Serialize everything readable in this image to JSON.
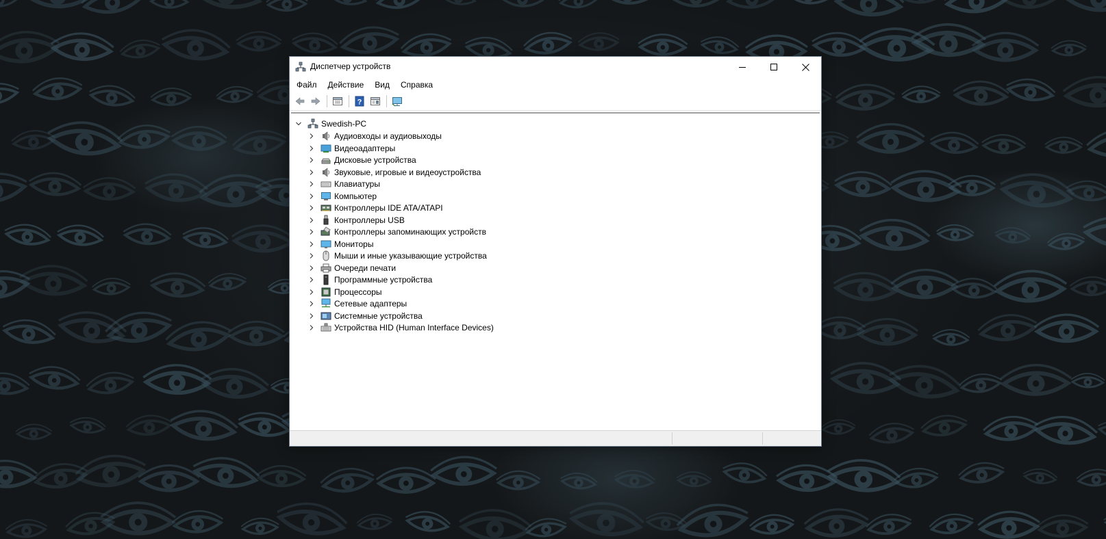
{
  "window": {
    "title": "Диспетчер устройств",
    "icon": "device-manager-icon"
  },
  "menu": [
    {
      "label": "Файл"
    },
    {
      "label": "Действие"
    },
    {
      "label": "Вид"
    },
    {
      "label": "Справка"
    }
  ],
  "toolbar": [
    {
      "name": "back-button",
      "icon": "arrow-left-icon"
    },
    {
      "name": "forward-button",
      "icon": "arrow-right-icon"
    },
    {
      "name": "properties-button",
      "icon": "properties-icon"
    },
    {
      "name": "help-button",
      "icon": "help-icon"
    },
    {
      "name": "details-view-button",
      "icon": "details-view-icon"
    },
    {
      "name": "scan-hardware-button",
      "icon": "monitor-scan-icon"
    }
  ],
  "tree": {
    "root": {
      "label": "Swedish-PC",
      "icon": "computer-network-icon",
      "expanded": true
    },
    "items": [
      {
        "label": "Аудиовходы и аудиовыходы",
        "icon": "speaker-icon"
      },
      {
        "label": "Видеоадаптеры",
        "icon": "display-adapter-icon"
      },
      {
        "label": "Дисковые устройства",
        "icon": "disk-drive-icon"
      },
      {
        "label": "Звуковые, игровые и видеоустройства",
        "icon": "speaker-icon"
      },
      {
        "label": "Клавиатуры",
        "icon": "keyboard-icon"
      },
      {
        "label": "Компьютер",
        "icon": "computer-icon"
      },
      {
        "label": "Контроллеры IDE ATA/ATAPI",
        "icon": "ide-controller-icon"
      },
      {
        "label": "Контроллеры USB",
        "icon": "usb-icon"
      },
      {
        "label": "Контроллеры запоминающих устройств",
        "icon": "storage-controller-icon"
      },
      {
        "label": "Мониторы",
        "icon": "monitor-icon"
      },
      {
        "label": "Мыши и иные указывающие устройства",
        "icon": "mouse-icon"
      },
      {
        "label": "Очереди печати",
        "icon": "printer-icon"
      },
      {
        "label": "Программные устройства",
        "icon": "software-device-icon"
      },
      {
        "label": "Процессоры",
        "icon": "processor-icon"
      },
      {
        "label": "Сетевые адаптеры",
        "icon": "network-adapter-icon"
      },
      {
        "label": "Системные устройства",
        "icon": "system-device-icon"
      },
      {
        "label": "Устройства HID (Human Interface Devices)",
        "icon": "hid-icon"
      }
    ]
  },
  "colors": {
    "desktop_bg": "#141719",
    "eye_pattern": "#3e5866",
    "window_border": "#6f7f8f"
  }
}
